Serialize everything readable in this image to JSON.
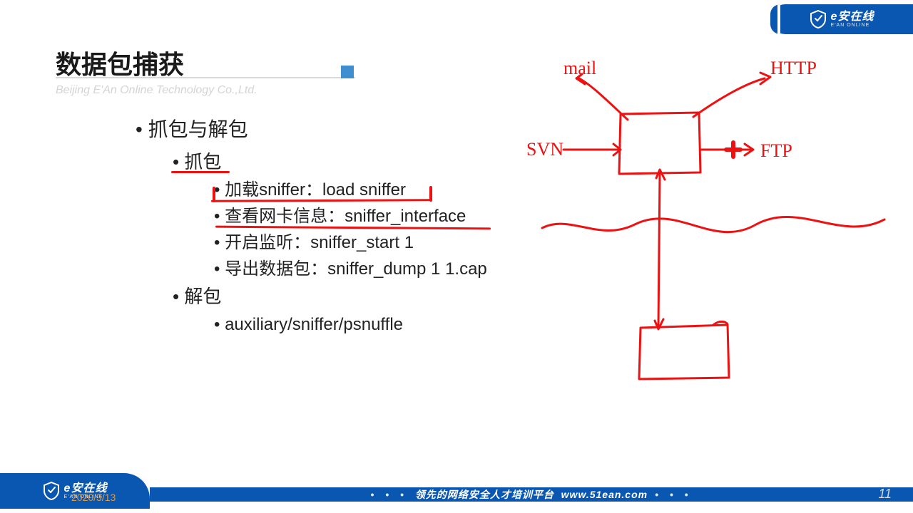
{
  "brand": {
    "name": "e安在线",
    "sub": "E'AN ONLINE"
  },
  "titleBlock": {
    "title": "数据包捕获",
    "subtitle": "Beijing E'An Online Technology Co.,Ltd."
  },
  "bullets": {
    "lvl1_a": "抓包与解包",
    "lvl2_a": "抓包",
    "lvl3_a1": "加载sniffer：load sniffer",
    "lvl3_a2": "查看网卡信息：sniffer_interface",
    "lvl3_a3": "开启监听：sniffer_start 1",
    "lvl3_a4": "导出数据包：sniffer_dump 1 1.cap",
    "lvl2_b": "解包",
    "lvl3_b1": "auxiliary/sniffer/psnuffle"
  },
  "diagram": {
    "labels": {
      "mail": "mail",
      "http": "HTTP",
      "svn": "SVN",
      "ftp": "FTP"
    }
  },
  "footer": {
    "tagline": "领先的网络安全人才培训平台",
    "url": "www.51ean.com",
    "dots": "• • •"
  },
  "meta": {
    "page": "11",
    "date": "2020/3/13"
  }
}
